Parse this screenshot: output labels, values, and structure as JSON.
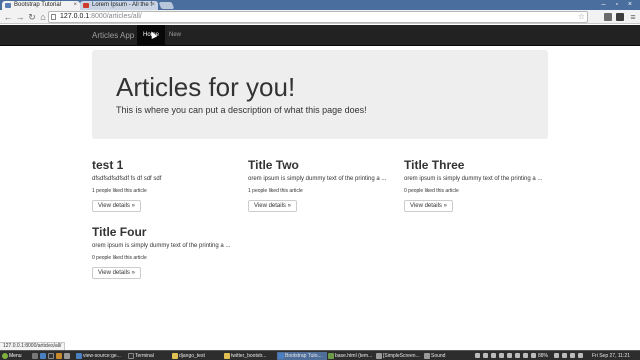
{
  "browser": {
    "tabs": [
      {
        "title": "Bootstrap Tutorial",
        "active": true
      },
      {
        "title": "Lorem Ipsum - All the f",
        "active": false
      }
    ],
    "url_host": "127.0.0.1",
    "url_path": ":8000/articles/all/",
    "status_url": "127.0.0.1:8000/articles/all/"
  },
  "navbar": {
    "brand": "Articles App",
    "items": [
      {
        "label": "Home",
        "active": true
      },
      {
        "label": "New",
        "active": false
      }
    ]
  },
  "jumbotron": {
    "title": "Articles for you!",
    "description": "This is where you can put a description of what this page does!"
  },
  "articles": [
    {
      "title": "test 1",
      "excerpt": "dfsdfsdfsdfsdf fs df sdf sdf",
      "likes": "1 people liked this article",
      "button": "View details »"
    },
    {
      "title": "Title Two",
      "excerpt": "orem ipsum is simply dummy text of the printing a ...",
      "likes": "1 people liked this article",
      "button": "View details »"
    },
    {
      "title": "Title Three",
      "excerpt": "orem ipsum is simply dummy text of the printing a ...",
      "likes": "0 people liked this article",
      "button": "View details »"
    },
    {
      "title": "Title Four",
      "excerpt": "orem ipsum is simply dummy text of the printing a ...",
      "likes": "0 people liked this article",
      "button": "View details »"
    }
  ],
  "taskbar": {
    "menu": "Menu",
    "tasks": [
      {
        "label": "view-source:ge...",
        "icon_color": "#4a7fc1"
      },
      {
        "label": "Terminal",
        "icon_color": "#333333"
      },
      {
        "label": "django_test",
        "icon_color": "#e0c050"
      },
      {
        "label": "twitter_bootstr...",
        "icon_color": "#e0c050"
      },
      {
        "label": "Bootstrap Tuto...",
        "icon_color": "#4a7fc1"
      },
      {
        "label": "base.html (tem...",
        "icon_color": "#6b9b4a"
      },
      {
        "label": "[SimpleScreen...",
        "icon_color": "#9a9a9a"
      },
      {
        "label": "Sound",
        "icon_color": "#9a9a9a"
      }
    ],
    "battery": "88%",
    "clock": "Fri Sep 27, 11:21"
  }
}
